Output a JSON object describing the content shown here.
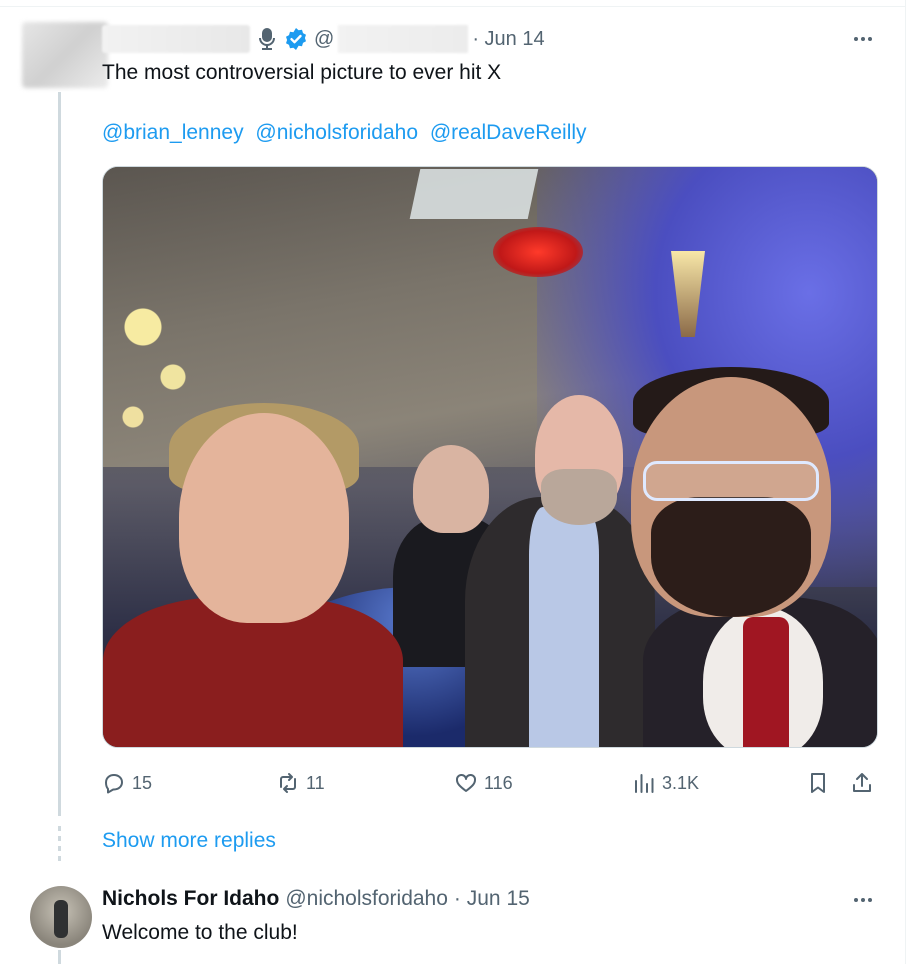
{
  "tweet": {
    "at_symbol": "@",
    "date": "· Jun 14",
    "text": "The most controversial picture to ever hit X",
    "mentions": [
      "@brian_lenney",
      "@nicholsforidaho",
      "@realDaveReilly"
    ],
    "stats": {
      "replies": "15",
      "reposts": "11",
      "likes": "116",
      "views": "3.1K"
    }
  },
  "show_more_replies": "Show more replies",
  "reply": {
    "name": "Nichols For Idaho",
    "handle": "@nicholsforidaho",
    "date": "· Jun 15",
    "text": "Welcome to the club!"
  },
  "icons": {
    "verified": "verified-badge-icon",
    "mic": "microphone-icon",
    "more": "more-options-icon",
    "reply": "reply-icon",
    "repost": "repost-icon",
    "like": "heart-icon",
    "views": "views-chart-icon",
    "bookmark": "bookmark-icon",
    "share": "share-icon"
  },
  "colors": {
    "accent": "#1d9bf0",
    "secondary_text": "#536471",
    "thread_line": "#cfd9de"
  }
}
